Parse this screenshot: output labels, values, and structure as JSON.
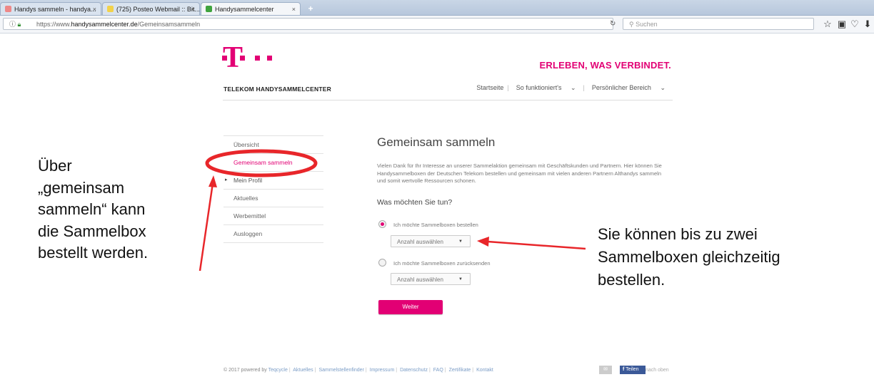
{
  "browser": {
    "tabs": [
      {
        "label": "Handys sammeln - handya...",
        "close": "×"
      },
      {
        "label": "(725) Posteo Webmail :: Bit...",
        "close": "×"
      },
      {
        "label": "Handysammelcenter",
        "close": "×"
      }
    ],
    "new_tab": "+",
    "url_prefix": "https://www.",
    "url_domain": "handysammelcenter.de",
    "url_path": "/Gemeinsamsammeln",
    "search_placeholder": "Suchen"
  },
  "header": {
    "logo_letter": "T",
    "slogan": "ERLEBEN, WAS VERBINDET.",
    "site_title": "TELEKOM HANDYSAMMELCENTER",
    "nav": [
      "Startseite",
      "So funktioniert's",
      "Persönlicher Bereich"
    ]
  },
  "sidebar": {
    "items": [
      {
        "label": "Übersicht"
      },
      {
        "label": "Gemeinsam sammeln"
      },
      {
        "label": "Mein Profil"
      },
      {
        "label": "Aktuelles"
      },
      {
        "label": "Werbemittel"
      },
      {
        "label": "Ausloggen"
      }
    ]
  },
  "main": {
    "title": "Gemeinsam sammeln",
    "intro": "Vielen Dank für Ihr Interesse an unserer Sammelaktion gemeinsam mit Geschäftskunden und Partnern. Hier können Sie Handysammelboxen der Deutschen Telekom bestellen und gemeinsam mit vielen anderen Partnern Althandys sammeln und somit wertvolle Ressourcen schonen.",
    "question": "Was möchten Sie tun?",
    "option_order": "Ich möchte Sammelboxen bestellen",
    "option_return": "Ich möchte Sammelboxen zurücksenden",
    "select_placeholder": "Anzahl auswählen",
    "submit": "Weiter"
  },
  "footer": {
    "copyright": "© 2017 powered by",
    "brand": "Teqcycle",
    "links": [
      "Aktuelles",
      "Sammelstellenfinder",
      "Impressum",
      "Datenschutz",
      "FAQ",
      "Zertifikate",
      "Kontakt"
    ],
    "share_label": "Teilen",
    "back_to_top": "nach oben"
  },
  "annotations": {
    "left": [
      "Über",
      "„gemeinsam",
      "sammeln“ kann",
      "die Sammelbox",
      "bestellt werden."
    ],
    "right": [
      "Sie können bis zu zwei",
      "Sammelboxen gleichzeitig",
      "bestellen."
    ]
  },
  "colors": {
    "magenta": "#e20074",
    "annotation_red": "#e8262a"
  }
}
